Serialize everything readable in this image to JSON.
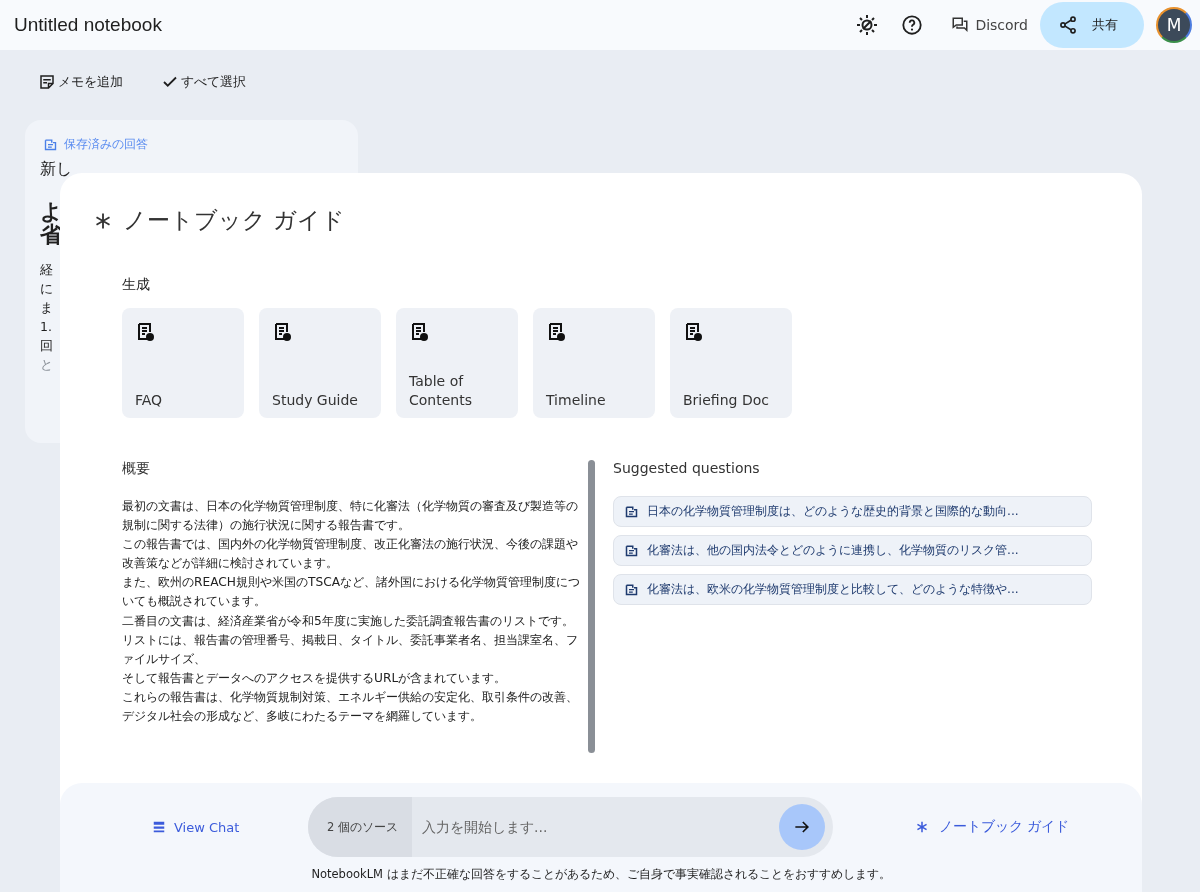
{
  "header": {
    "title": "Untitled notebook",
    "discord": "Discord",
    "share": "共有",
    "avatar": "M"
  },
  "toolbar": {
    "add_note": "メモを追加",
    "select_all": "すべて選択"
  },
  "note_card": {
    "tag": "保存済みの回答",
    "title": "新し",
    "heading": [
      "よ",
      "省"
    ],
    "lines": [
      "経",
      "に",
      "ま",
      "1.",
      "回",
      "と"
    ]
  },
  "guide": {
    "title": "ノートブック ガイド",
    "generate_label": "生成",
    "tiles": [
      {
        "label": "FAQ"
      },
      {
        "label": "Study Guide"
      },
      {
        "label": "Table of Contents"
      },
      {
        "label": "Timeline"
      },
      {
        "label": "Briefing Doc"
      }
    ],
    "summary_label": "概要",
    "summary": [
      "最初の文書は、日本の化学物質管理制度、特に化審法（化学物質の審査及び製造等の規制に関する法律）の施行状況に関する報告書です。",
      "この報告書では、国内外の化学物質管理制度、改正化審法の施行状況、今後の課題や改善策などが詳細に検討されています。",
      "また、欧州のREACH規則や米国のTSCAなど、諸外国における化学物質管理制度についても概説されています。",
      "二番目の文書は、経済産業省が令和5年度に実施した委託調査報告書のリストです。",
      "リストには、報告書の管理番号、掲載日、タイトル、委託事業者名、担当課室名、ファイルサイズ、",
      "そして報告書とデータへのアクセスを提供するURLが含まれています。",
      "これらの報告書は、化学物質規制対策、エネルギー供給の安定化、取引条件の改善、",
      "デジタル社会の形成など、多岐にわたるテーマを網羅しています。"
    ],
    "questions_label": "Suggested questions",
    "questions": [
      "日本の化学物質管理制度は、どのような歴史的背景と国際的な動向...",
      "化審法は、他の国内法令とどのように連携し、化学物質のリスク管...",
      "化審法は、欧米の化学物質管理制度と比較して、どのような特徴や..."
    ]
  },
  "bottom": {
    "view_chat": "View Chat",
    "sources": "2 個のソース",
    "placeholder": "入力を開始します...",
    "guide": "ノートブック ガイド",
    "disclaimer": "NotebookLM はまだ不正確な回答をすることがあるため、ご自身で事実確認されることをおすすめします。"
  }
}
